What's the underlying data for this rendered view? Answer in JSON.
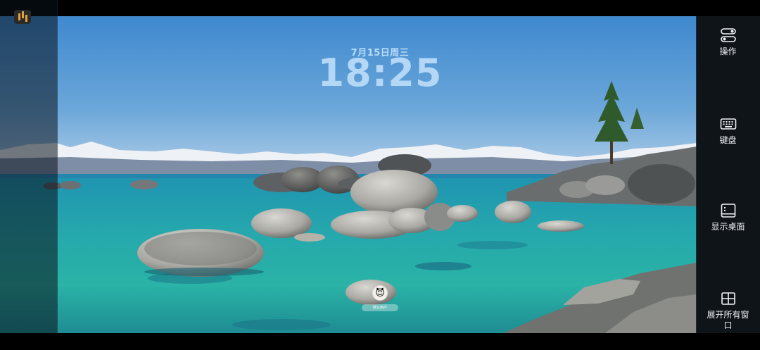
{
  "lock_screen": {
    "date": "7月15日周三",
    "time": "18:25"
  },
  "user": {
    "avatar_glyph": "😈",
    "name": "默认用户"
  },
  "side_panel": {
    "items": [
      {
        "label": "操作",
        "icon": "toggle-switches-icon"
      },
      {
        "label": "键盘",
        "icon": "keyboard-icon"
      },
      {
        "label": "显示桌面",
        "icon": "desktop-icon"
      },
      {
        "label": "展开所有窗口",
        "icon": "window-grid-icon"
      }
    ]
  },
  "colors": {
    "clock": "#b5d7f6",
    "panel_bg": "#12181e",
    "panel_text": "#eef1f4"
  }
}
